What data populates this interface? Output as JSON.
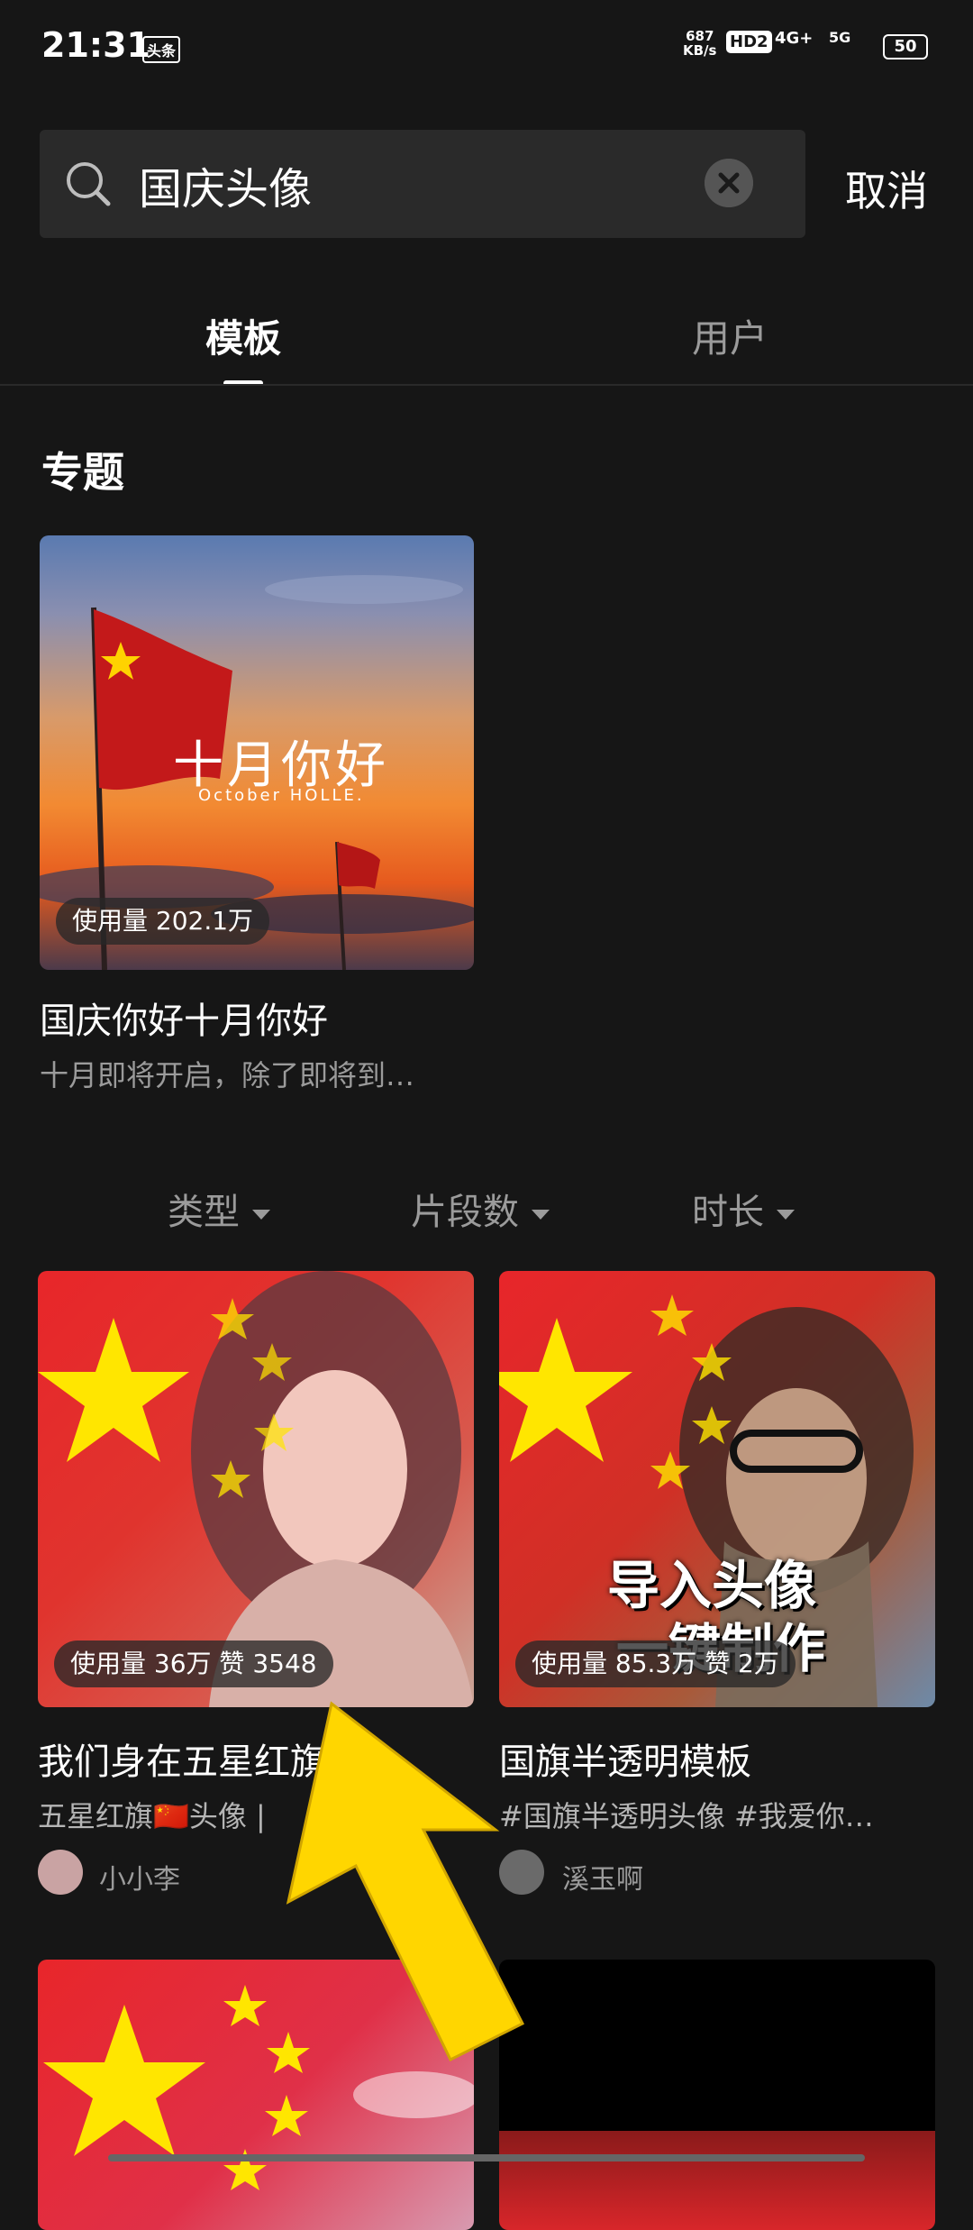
{
  "status_bar": {
    "time": "21:31",
    "app_badge": "头条",
    "net_speed_top": "687",
    "net_speed_bottom": "KB/s",
    "hd_label": "HD2",
    "network_4g": "4G+",
    "network_5g": "5G",
    "battery": "50"
  },
  "search": {
    "query": "国庆头像",
    "cancel_label": "取消"
  },
  "tabs": [
    {
      "label": "模板",
      "active": true
    },
    {
      "label": "用户",
      "active": false
    }
  ],
  "topic": {
    "section_title": "专题",
    "image_text_title": "十月你好",
    "image_text_subtitle": "October HOLLE.",
    "usage_badge": "使用量 202.1万",
    "title": "国庆你好十月你好",
    "description": "十月即将开启，除了即将到…"
  },
  "filters": [
    {
      "label": "类型"
    },
    {
      "label": "片段数"
    },
    {
      "label": "时长"
    }
  ],
  "templates": [
    {
      "badge": "使用量 36万 赞 3548",
      "title": "我们身在五星红旗",
      "tags": "五星红旗🇨🇳头像 | ",
      "author": "小小李"
    },
    {
      "badge": "使用量 85.3万 赞 2万",
      "overlay_line1": "导入头像",
      "overlay_line2": "一键制作",
      "title": "国旗半透明模板",
      "tags": "#国旗半透明头像 #我爱你…",
      "author": "溪玉啊"
    }
  ],
  "colors": {
    "background": "#161616",
    "flag_red": "#e8262a",
    "star_yellow": "#ffe600",
    "annotation_arrow": "#ffd600"
  }
}
